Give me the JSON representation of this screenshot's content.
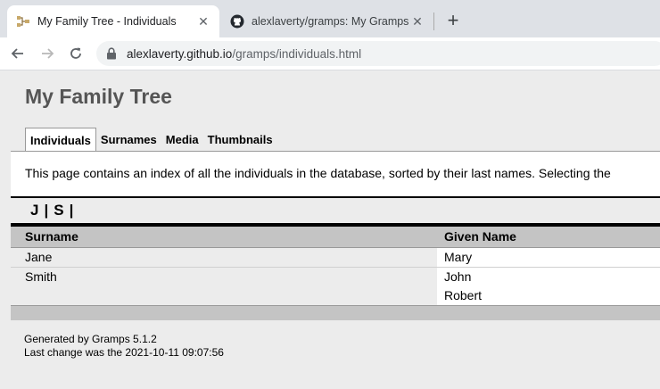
{
  "browser": {
    "tabs": [
      {
        "title": "My Family Tree - Individuals",
        "favicon": "gramps-tree-icon",
        "active": true
      },
      {
        "title": "alexlaverty/gramps: My Gramps F",
        "favicon": "github-icon",
        "active": false
      }
    ],
    "url_host": "alexlaverty.github.io",
    "url_path": "/gramps/individuals.html"
  },
  "site": {
    "title": "My Family Tree",
    "nav": [
      "Individuals",
      "Surnames",
      "Media",
      "Thumbnails"
    ],
    "current_nav": "Individuals"
  },
  "description": "This page contains an index of all the individuals in the database, sorted by their last names. Selecting the",
  "alphabet": [
    "J",
    "|",
    "S",
    "|"
  ],
  "table": {
    "columns": [
      "Surname",
      "Given Name"
    ],
    "rows": [
      {
        "surname": "Jane",
        "given": [
          "Mary"
        ]
      },
      {
        "surname": "Smith",
        "given": [
          "John",
          "Robert"
        ]
      }
    ]
  },
  "footer": {
    "generated": "Generated by Gramps 5.1.2",
    "last_change": "Last change was the 2021-10-11 09:07:56"
  }
}
